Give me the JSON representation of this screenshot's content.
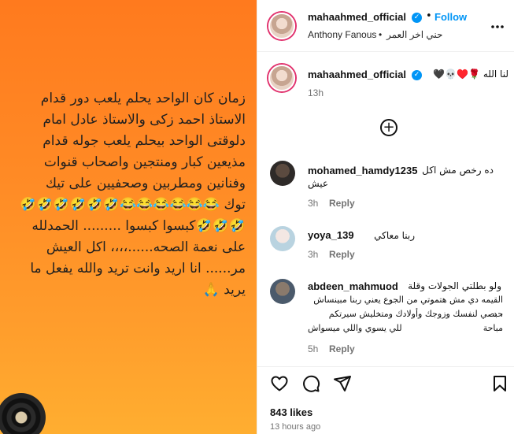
{
  "post": {
    "text": "زمان كان الواحد يحلم يلعب دور قدام\nالاستاذ احمد زكى والاستاذ عادل امام\nدلوقتى الواحد بيحلم يلعب جوله قدام\nمذيعين كبار ومنتجين واصحاب قنوات\nوفنانين ومطربين وصحفيين  على تيك\nتوك 😂😂😂😂😂😂🤣🤣🤣🤣🤣🤣\n🤣🤣🤣كبسوا كبسوا ......... الحمدلله\nعلى نعمة الصحه......،،،، اكل العيش\nمر...... انا اريد وانت تريد والله يفعل ما\nيريد 🙏"
  },
  "header": {
    "username": "mahaahmed_official",
    "follow_label": "Follow",
    "dot": "•",
    "subline_left": "Anthony Fanous",
    "subline_sep": "•",
    "subline_right": "حني اخر العمر",
    "more_icon": "more-icon"
  },
  "caption": {
    "username": "mahaahmed_official",
    "text": "لنا الله 🌹♥️💀🖤",
    "time": "13h"
  },
  "comments": [
    {
      "username": "mohamed_hamdy1235",
      "text_line1": "ده رخص مش اكل",
      "text_line2": "عيش",
      "time": "3h",
      "reply": "Reply"
    },
    {
      "username": "yoya_139",
      "text_line1": "ربنا معاكي",
      "time": "3h",
      "reply": "Reply"
    },
    {
      "username": "abdeen_mahmuod",
      "text_line1": "ولو بطلتي الجولات وقلة",
      "text_line2": "القيمه دي مش هتموتي من الجوع يعني ربنا مبينساش حد",
      "text_line3": "، بصي لنفسك وزوجك وأولادك ومتخليش سيرتكم مباحة",
      "text_line4": "للي يسوي واللي ميسواش",
      "time": "5h",
      "reply": "Reply"
    }
  ],
  "footer": {
    "likes": "843 likes",
    "time": "13 hours ago"
  },
  "colors": {
    "accent": "#0095f6",
    "gradient_top": "#ff7a1e",
    "gradient_bottom": "#ffae30"
  }
}
